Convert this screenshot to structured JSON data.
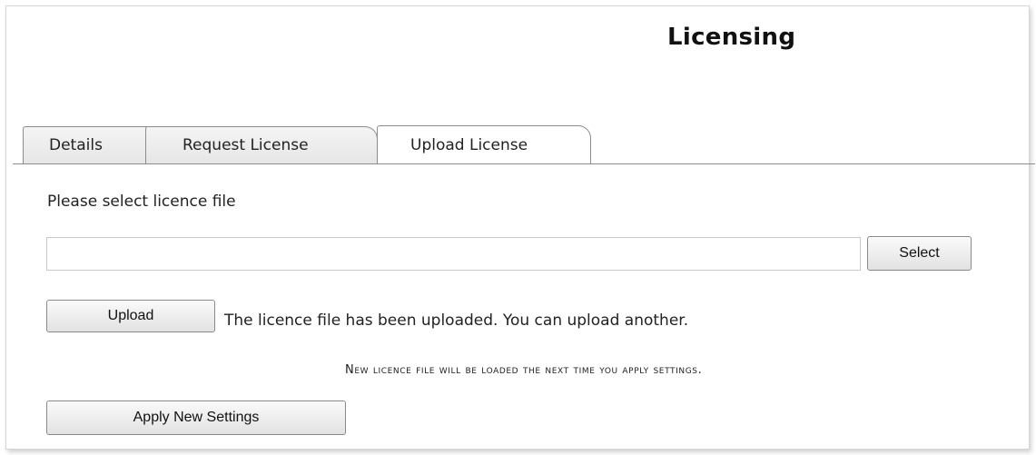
{
  "page": {
    "title": "Licensing"
  },
  "tabs": [
    {
      "label": "Details",
      "active": false
    },
    {
      "label": "Request License",
      "active": false
    },
    {
      "label": "Upload License",
      "active": true
    }
  ],
  "upload_form": {
    "prompt": "Please select licence file",
    "file_input_value": "",
    "select_label": "Select",
    "upload_label": "Upload",
    "status_message": "The licence file has been uploaded. You can upload another.",
    "notice": "New licence file will be loaded the next time you apply settings.",
    "apply_label": "Apply New Settings"
  },
  "colors": {
    "tab_border": "#8c8c8c",
    "button_border": "#8a8a8a",
    "text": "#222222"
  }
}
